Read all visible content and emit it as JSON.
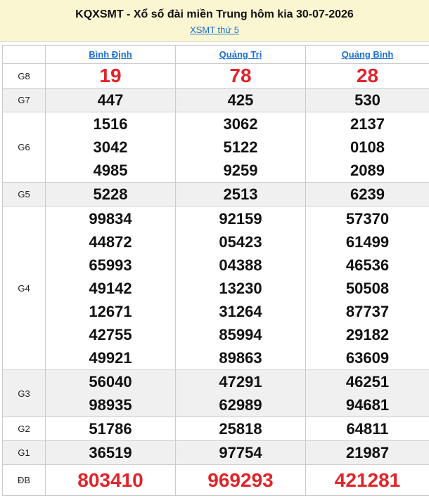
{
  "header": {
    "title": "KQXSMT - Xổ số đài miền Trung hôm kia 30-07-2026",
    "subtitle_link": "XSMT thứ 5"
  },
  "columns": [
    "Bình Định",
    "Quảng Trị",
    "Quảng Bình"
  ],
  "prizes": [
    {
      "label": "G8",
      "values": [
        [
          "19"
        ],
        [
          "78"
        ],
        [
          "28"
        ]
      ]
    },
    {
      "label": "G7",
      "values": [
        [
          "447"
        ],
        [
          "425"
        ],
        [
          "530"
        ]
      ]
    },
    {
      "label": "G6",
      "values": [
        [
          "1516",
          "3042",
          "4985"
        ],
        [
          "3062",
          "5122",
          "9259"
        ],
        [
          "2137",
          "0108",
          "2089"
        ]
      ]
    },
    {
      "label": "G5",
      "values": [
        [
          "5228"
        ],
        [
          "2513"
        ],
        [
          "6239"
        ]
      ]
    },
    {
      "label": "G4",
      "values": [
        [
          "99834",
          "44872",
          "65993",
          "49142",
          "12671",
          "42755",
          "49921"
        ],
        [
          "92159",
          "05423",
          "04388",
          "13230",
          "31264",
          "85994",
          "89863"
        ],
        [
          "57370",
          "61499",
          "46536",
          "50508",
          "87737",
          "29182",
          "63609"
        ]
      ]
    },
    {
      "label": "G3",
      "values": [
        [
          "56040",
          "98935"
        ],
        [
          "47291",
          "62989"
        ],
        [
          "46251",
          "94681"
        ]
      ]
    },
    {
      "label": "G2",
      "values": [
        [
          "51786"
        ],
        [
          "25818"
        ],
        [
          "64811"
        ]
      ]
    },
    {
      "label": "G1",
      "values": [
        [
          "36519"
        ],
        [
          "97754"
        ],
        [
          "21987"
        ]
      ]
    },
    {
      "label": "ĐB",
      "values": [
        [
          "803410"
        ],
        [
          "969293"
        ],
        [
          "421281"
        ]
      ]
    }
  ],
  "colors": {
    "header_bg": "#fbf6d2",
    "link": "#1a6fd1",
    "highlight_red": "#e0242a",
    "alt_row": "#f0f0f0"
  }
}
